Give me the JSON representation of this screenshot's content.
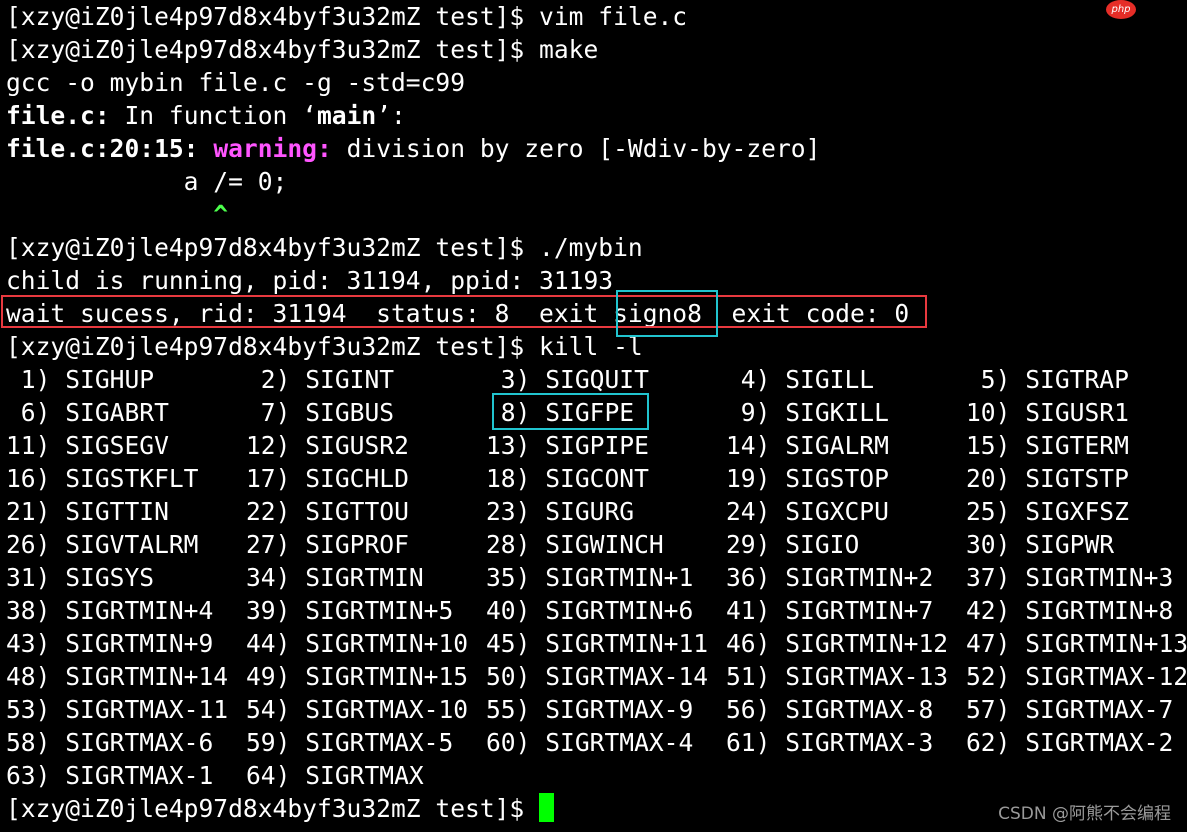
{
  "terminal": {
    "lines": [
      "[xzy@iZ0jle4p97d8x4byf3u32mZ test]$ vim file.c",
      "[xzy@iZ0jle4p97d8x4byf3u32mZ test]$ make",
      "gcc -o mybin file.c -g -std=c99",
      "",
      "",
      "            a /= 0;",
      "",
      "[xzy@iZ0jle4p97d8x4byf3u32mZ test]$ ./mybin",
      "child is running, pid: 31194, ppid: 31193",
      "",
      "[xzy@iZ0jle4p97d8x4byf3u32mZ test]$ kill -l"
    ],
    "func_line": {
      "file": "file.c:",
      "mid": " In function ‘",
      "func": "main",
      "end": "’:"
    },
    "warn_line": {
      "loc": "file.c:20:15:",
      "sp": " ",
      "kw": "warning:",
      "msg": " division by zero [-Wdiv-by-zero]"
    },
    "caret_line": {
      "pad": "              ",
      "caret": "^"
    },
    "wait_line": {
      "pre": "wait sucess, rid: 31194  status: 8  exit ",
      "signo": "signo8",
      "post": "  exit code: 0"
    },
    "final_prompt": "[xzy@iZ0jle4p97d8x4byf3u32mZ test]$ "
  },
  "signals": [
    [
      " 1) SIGHUP",
      " 2) SIGINT",
      " 3) SIGQUIT",
      " 4) SIGILL",
      " 5) SIGTRAP"
    ],
    [
      " 6) SIGABRT",
      " 7) SIGBUS",
      " 8) SIGFPE",
      " 9) SIGKILL",
      "10) SIGUSR1"
    ],
    [
      "11) SIGSEGV",
      "12) SIGUSR2",
      "13) SIGPIPE",
      "14) SIGALRM",
      "15) SIGTERM"
    ],
    [
      "16) SIGSTKFLT",
      "17) SIGCHLD",
      "18) SIGCONT",
      "19) SIGSTOP",
      "20) SIGTSTP"
    ],
    [
      "21) SIGTTIN",
      "22) SIGTTOU",
      "23) SIGURG",
      "24) SIGXCPU",
      "25) SIGXFSZ"
    ],
    [
      "26) SIGVTALRM",
      "27) SIGPROF",
      "28) SIGWINCH",
      "29) SIGIO",
      "30) SIGPWR"
    ],
    [
      "31) SIGSYS",
      "34) SIGRTMIN",
      "35) SIGRTMIN+1",
      "36) SIGRTMIN+2",
      "37) SIGRTMIN+3"
    ],
    [
      "38) SIGRTMIN+4",
      "39) SIGRTMIN+5",
      "40) SIGRTMIN+6",
      "41) SIGRTMIN+7",
      "42) SIGRTMIN+8"
    ],
    [
      "43) SIGRTMIN+9",
      "44) SIGRTMIN+10",
      "45) SIGRTMIN+11",
      "46) SIGRTMIN+12",
      "47) SIGRTMIN+13"
    ],
    [
      "48) SIGRTMIN+14",
      "49) SIGRTMIN+15",
      "50) SIGRTMAX-14",
      "51) SIGRTMAX-13",
      "52) SIGRTMAX-12"
    ],
    [
      "53) SIGRTMAX-11",
      "54) SIGRTMAX-10",
      "55) SIGRTMAX-9",
      "56) SIGRTMAX-8",
      "57) SIGRTMAX-7"
    ],
    [
      "58) SIGRTMAX-6",
      "59) SIGRTMAX-5",
      "60) SIGRTMAX-4",
      "61) SIGRTMAX-3",
      "62) SIGRTMAX-2"
    ],
    [
      "63) SIGRTMAX-1",
      "64) SIGRTMAX"
    ]
  ],
  "overlay": {
    "badge": "php",
    "watermark": "CSDN @阿熊不会编程"
  },
  "colors": {
    "background": "#000000",
    "text": "#ffffff",
    "warning": "#ff55ff",
    "caret": "#4cff4c",
    "cursor": "#00ff00",
    "highlight_red": "#e8393f",
    "highlight_cyan": "#21c4cf"
  }
}
